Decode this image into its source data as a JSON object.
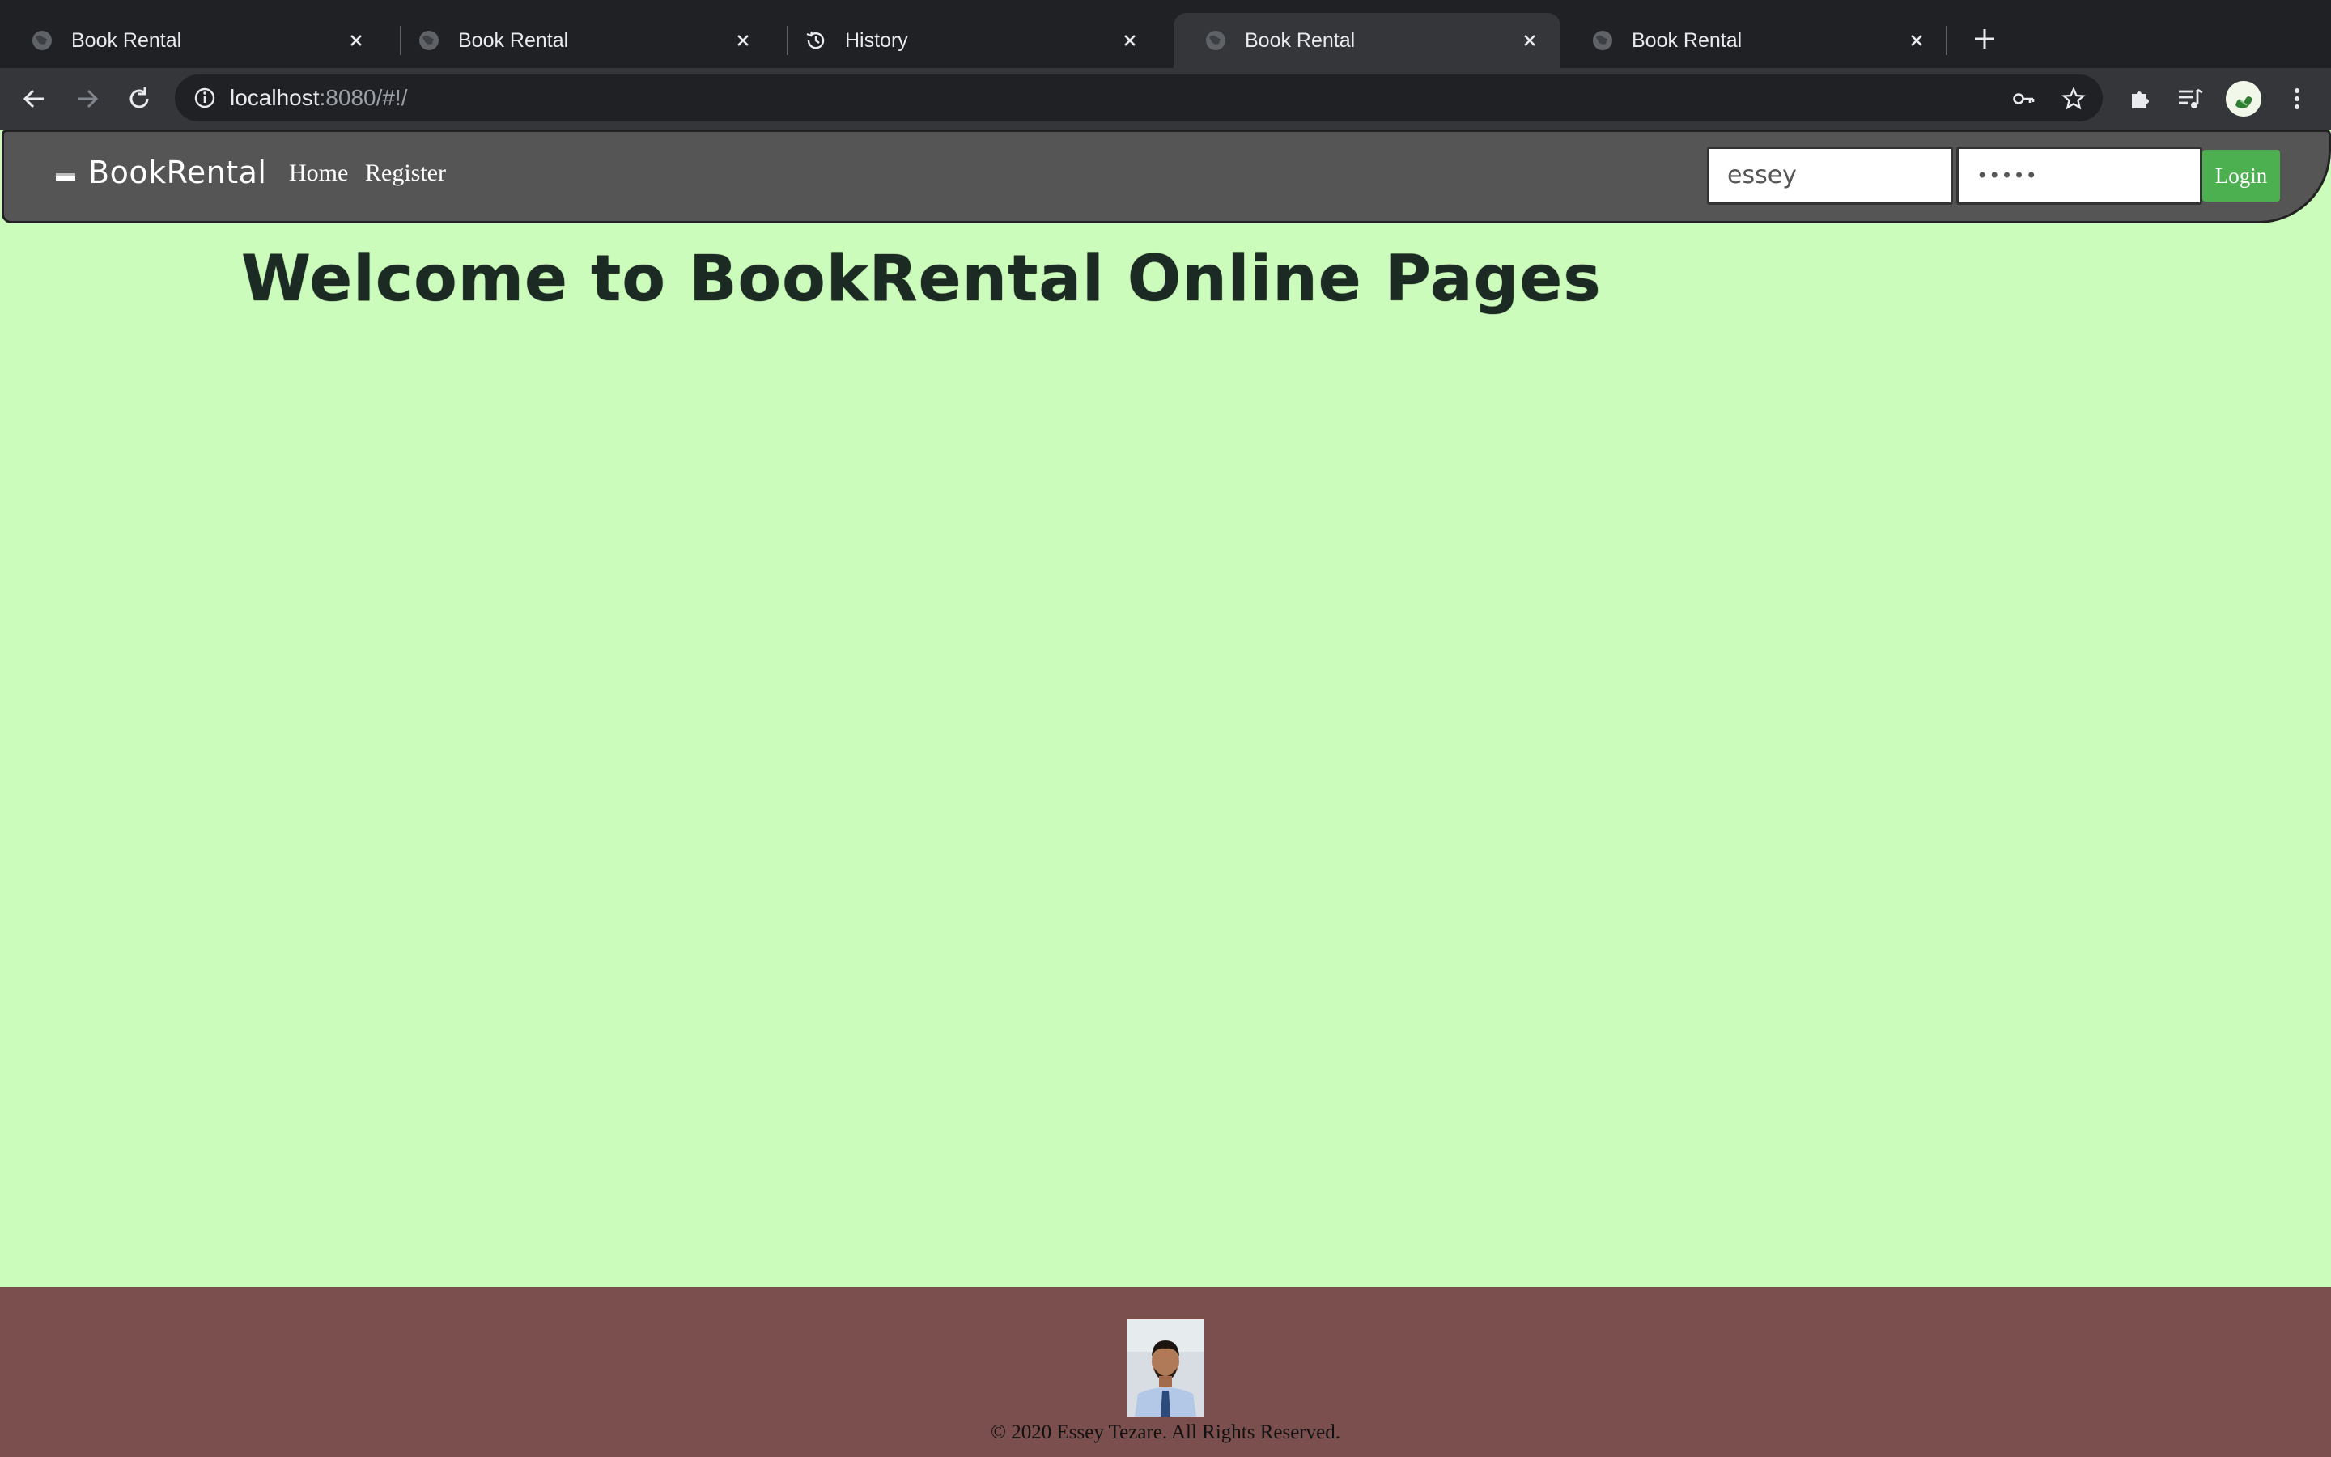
{
  "browser": {
    "tabs": [
      {
        "title": "Book Rental",
        "icon": "globe-icon",
        "active": false
      },
      {
        "title": "Book Rental",
        "icon": "globe-icon",
        "active": false
      },
      {
        "title": "History",
        "icon": "history-icon",
        "active": false
      },
      {
        "title": "Book Rental",
        "icon": "globe-icon",
        "active": true
      },
      {
        "title": "Book Rental",
        "icon": "globe-icon",
        "active": false
      }
    ],
    "url": {
      "host": "localhost",
      "rest": ":8080/#!/"
    }
  },
  "navbar": {
    "brand": "BookRental",
    "links": [
      "Home",
      "Register"
    ],
    "username_value": "essey",
    "password_value": "•••••",
    "login_label": "Login",
    "bg_color": "#555555"
  },
  "main": {
    "heading": "Welcome to BookRental Online Pages",
    "bg_color": "#ccfcbc"
  },
  "footer": {
    "copyright": "© 2020 Essey Tezare. All Rights Reserved.",
    "bg_color": "#7a4f4e"
  }
}
